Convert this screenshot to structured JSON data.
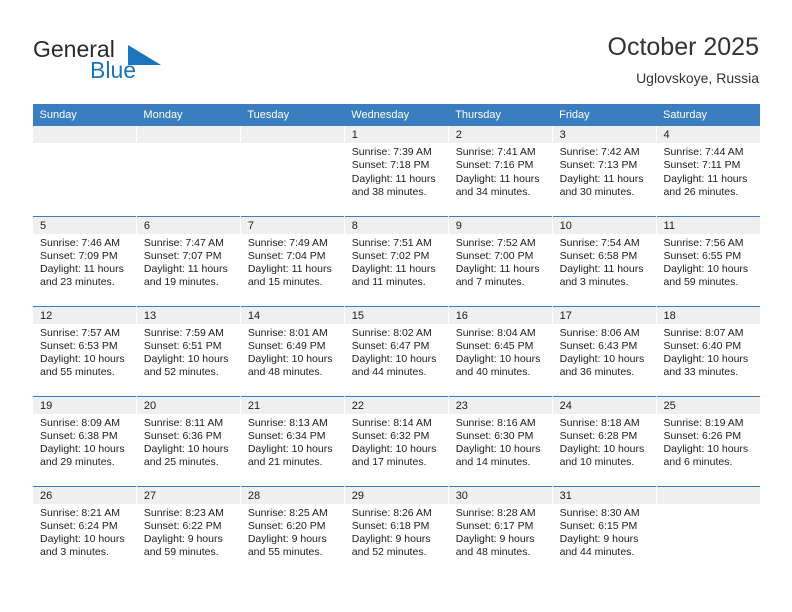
{
  "brand": {
    "word1": "General",
    "word2": "Blue",
    "logo_color": "#1b75bb"
  },
  "header": {
    "title": "October 2025",
    "location": "Uglovskoye, Russia"
  },
  "theme": {
    "header_row_bg": "#3a7ebf",
    "daynum_strip_bg": "#efefef",
    "text_color": "#1c1c1c"
  },
  "weekday_headers": [
    "Sunday",
    "Monday",
    "Tuesday",
    "Wednesday",
    "Thursday",
    "Friday",
    "Saturday"
  ],
  "labels": {
    "sunrise_prefix": "Sunrise:",
    "sunset_prefix": "Sunset:",
    "daylight_prefix": "Daylight:"
  },
  "weeks": [
    [
      {
        "day": "",
        "empty": true,
        "l1": "",
        "l2": "",
        "l3": "",
        "l4": ""
      },
      {
        "day": "",
        "empty": true,
        "l1": "",
        "l2": "",
        "l3": "",
        "l4": ""
      },
      {
        "day": "",
        "empty": true,
        "l1": "",
        "l2": "",
        "l3": "",
        "l4": ""
      },
      {
        "day": "1",
        "l1": "Sunrise: 7:39 AM",
        "l2": "Sunset: 7:18 PM",
        "l3": "Daylight: 11 hours",
        "l4": "and 38 minutes."
      },
      {
        "day": "2",
        "l1": "Sunrise: 7:41 AM",
        "l2": "Sunset: 7:16 PM",
        "l3": "Daylight: 11 hours",
        "l4": "and 34 minutes."
      },
      {
        "day": "3",
        "l1": "Sunrise: 7:42 AM",
        "l2": "Sunset: 7:13 PM",
        "l3": "Daylight: 11 hours",
        "l4": "and 30 minutes."
      },
      {
        "day": "4",
        "l1": "Sunrise: 7:44 AM",
        "l2": "Sunset: 7:11 PM",
        "l3": "Daylight: 11 hours",
        "l4": "and 26 minutes."
      }
    ],
    [
      {
        "day": "5",
        "l1": "Sunrise: 7:46 AM",
        "l2": "Sunset: 7:09 PM",
        "l3": "Daylight: 11 hours",
        "l4": "and 23 minutes."
      },
      {
        "day": "6",
        "l1": "Sunrise: 7:47 AM",
        "l2": "Sunset: 7:07 PM",
        "l3": "Daylight: 11 hours",
        "l4": "and 19 minutes."
      },
      {
        "day": "7",
        "l1": "Sunrise: 7:49 AM",
        "l2": "Sunset: 7:04 PM",
        "l3": "Daylight: 11 hours",
        "l4": "and 15 minutes."
      },
      {
        "day": "8",
        "l1": "Sunrise: 7:51 AM",
        "l2": "Sunset: 7:02 PM",
        "l3": "Daylight: 11 hours",
        "l4": "and 11 minutes."
      },
      {
        "day": "9",
        "l1": "Sunrise: 7:52 AM",
        "l2": "Sunset: 7:00 PM",
        "l3": "Daylight: 11 hours",
        "l4": "and 7 minutes."
      },
      {
        "day": "10",
        "l1": "Sunrise: 7:54 AM",
        "l2": "Sunset: 6:58 PM",
        "l3": "Daylight: 11 hours",
        "l4": "and 3 minutes."
      },
      {
        "day": "11",
        "l1": "Sunrise: 7:56 AM",
        "l2": "Sunset: 6:55 PM",
        "l3": "Daylight: 10 hours",
        "l4": "and 59 minutes."
      }
    ],
    [
      {
        "day": "12",
        "l1": "Sunrise: 7:57 AM",
        "l2": "Sunset: 6:53 PM",
        "l3": "Daylight: 10 hours",
        "l4": "and 55 minutes."
      },
      {
        "day": "13",
        "l1": "Sunrise: 7:59 AM",
        "l2": "Sunset: 6:51 PM",
        "l3": "Daylight: 10 hours",
        "l4": "and 52 minutes."
      },
      {
        "day": "14",
        "l1": "Sunrise: 8:01 AM",
        "l2": "Sunset: 6:49 PM",
        "l3": "Daylight: 10 hours",
        "l4": "and 48 minutes."
      },
      {
        "day": "15",
        "l1": "Sunrise: 8:02 AM",
        "l2": "Sunset: 6:47 PM",
        "l3": "Daylight: 10 hours",
        "l4": "and 44 minutes."
      },
      {
        "day": "16",
        "l1": "Sunrise: 8:04 AM",
        "l2": "Sunset: 6:45 PM",
        "l3": "Daylight: 10 hours",
        "l4": "and 40 minutes."
      },
      {
        "day": "17",
        "l1": "Sunrise: 8:06 AM",
        "l2": "Sunset: 6:43 PM",
        "l3": "Daylight: 10 hours",
        "l4": "and 36 minutes."
      },
      {
        "day": "18",
        "l1": "Sunrise: 8:07 AM",
        "l2": "Sunset: 6:40 PM",
        "l3": "Daylight: 10 hours",
        "l4": "and 33 minutes."
      }
    ],
    [
      {
        "day": "19",
        "l1": "Sunrise: 8:09 AM",
        "l2": "Sunset: 6:38 PM",
        "l3": "Daylight: 10 hours",
        "l4": "and 29 minutes."
      },
      {
        "day": "20",
        "l1": "Sunrise: 8:11 AM",
        "l2": "Sunset: 6:36 PM",
        "l3": "Daylight: 10 hours",
        "l4": "and 25 minutes."
      },
      {
        "day": "21",
        "l1": "Sunrise: 8:13 AM",
        "l2": "Sunset: 6:34 PM",
        "l3": "Daylight: 10 hours",
        "l4": "and 21 minutes."
      },
      {
        "day": "22",
        "l1": "Sunrise: 8:14 AM",
        "l2": "Sunset: 6:32 PM",
        "l3": "Daylight: 10 hours",
        "l4": "and 17 minutes."
      },
      {
        "day": "23",
        "l1": "Sunrise: 8:16 AM",
        "l2": "Sunset: 6:30 PM",
        "l3": "Daylight: 10 hours",
        "l4": "and 14 minutes."
      },
      {
        "day": "24",
        "l1": "Sunrise: 8:18 AM",
        "l2": "Sunset: 6:28 PM",
        "l3": "Daylight: 10 hours",
        "l4": "and 10 minutes."
      },
      {
        "day": "25",
        "l1": "Sunrise: 8:19 AM",
        "l2": "Sunset: 6:26 PM",
        "l3": "Daylight: 10 hours",
        "l4": "and 6 minutes."
      }
    ],
    [
      {
        "day": "26",
        "l1": "Sunrise: 8:21 AM",
        "l2": "Sunset: 6:24 PM",
        "l3": "Daylight: 10 hours",
        "l4": "and 3 minutes."
      },
      {
        "day": "27",
        "l1": "Sunrise: 8:23 AM",
        "l2": "Sunset: 6:22 PM",
        "l3": "Daylight: 9 hours",
        "l4": "and 59 minutes."
      },
      {
        "day": "28",
        "l1": "Sunrise: 8:25 AM",
        "l2": "Sunset: 6:20 PM",
        "l3": "Daylight: 9 hours",
        "l4": "and 55 minutes."
      },
      {
        "day": "29",
        "l1": "Sunrise: 8:26 AM",
        "l2": "Sunset: 6:18 PM",
        "l3": "Daylight: 9 hours",
        "l4": "and 52 minutes."
      },
      {
        "day": "30",
        "l1": "Sunrise: 8:28 AM",
        "l2": "Sunset: 6:17 PM",
        "l3": "Daylight: 9 hours",
        "l4": "and 48 minutes."
      },
      {
        "day": "31",
        "l1": "Sunrise: 8:30 AM",
        "l2": "Sunset: 6:15 PM",
        "l3": "Daylight: 9 hours",
        "l4": "and 44 minutes."
      },
      {
        "day": "",
        "empty": true,
        "l1": "",
        "l2": "",
        "l3": "",
        "l4": ""
      }
    ]
  ]
}
